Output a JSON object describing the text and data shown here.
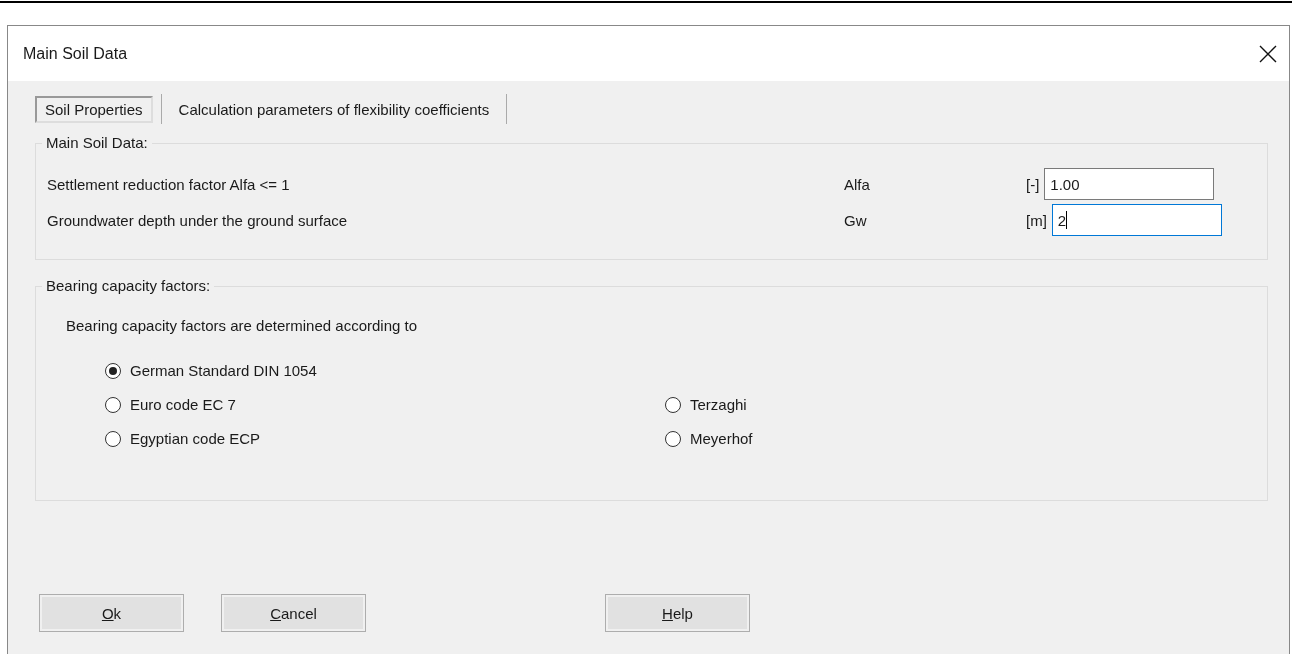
{
  "window": {
    "title": "Main Soil Data"
  },
  "tabs": [
    {
      "label": "Soil Properties",
      "selected": true
    },
    {
      "label": "Calculation parameters of flexibility coefficients",
      "selected": false
    }
  ],
  "main_group": {
    "title": "Main Soil Data:",
    "rows": [
      {
        "description": "Settlement reduction factor Alfa <= 1",
        "symbol": "Alfa",
        "unit": "[-]",
        "value": "1.00",
        "focused": false
      },
      {
        "description": "Groundwater depth under the ground surface",
        "symbol": "Gw",
        "unit": "[m]",
        "value": "2",
        "focused": true
      }
    ]
  },
  "bearing_group": {
    "title": "Bearing capacity factors:",
    "intro": "Bearing capacity factors are determined according to",
    "option_rows": [
      [
        {
          "label": "German Standard DIN 1054",
          "selected": true
        }
      ],
      [
        {
          "label": "Euro code EC 7",
          "selected": false
        },
        {
          "label": "Terzaghi",
          "selected": false
        }
      ],
      [
        {
          "label": "Egyptian code ECP",
          "selected": false
        },
        {
          "label": "Meyerhof",
          "selected": false
        }
      ]
    ]
  },
  "buttons": [
    {
      "label": "Ok",
      "mnemonic": true
    },
    {
      "label": "Cancel",
      "mnemonic": true
    },
    {
      "label": "Help",
      "mnemonic": true
    }
  ]
}
